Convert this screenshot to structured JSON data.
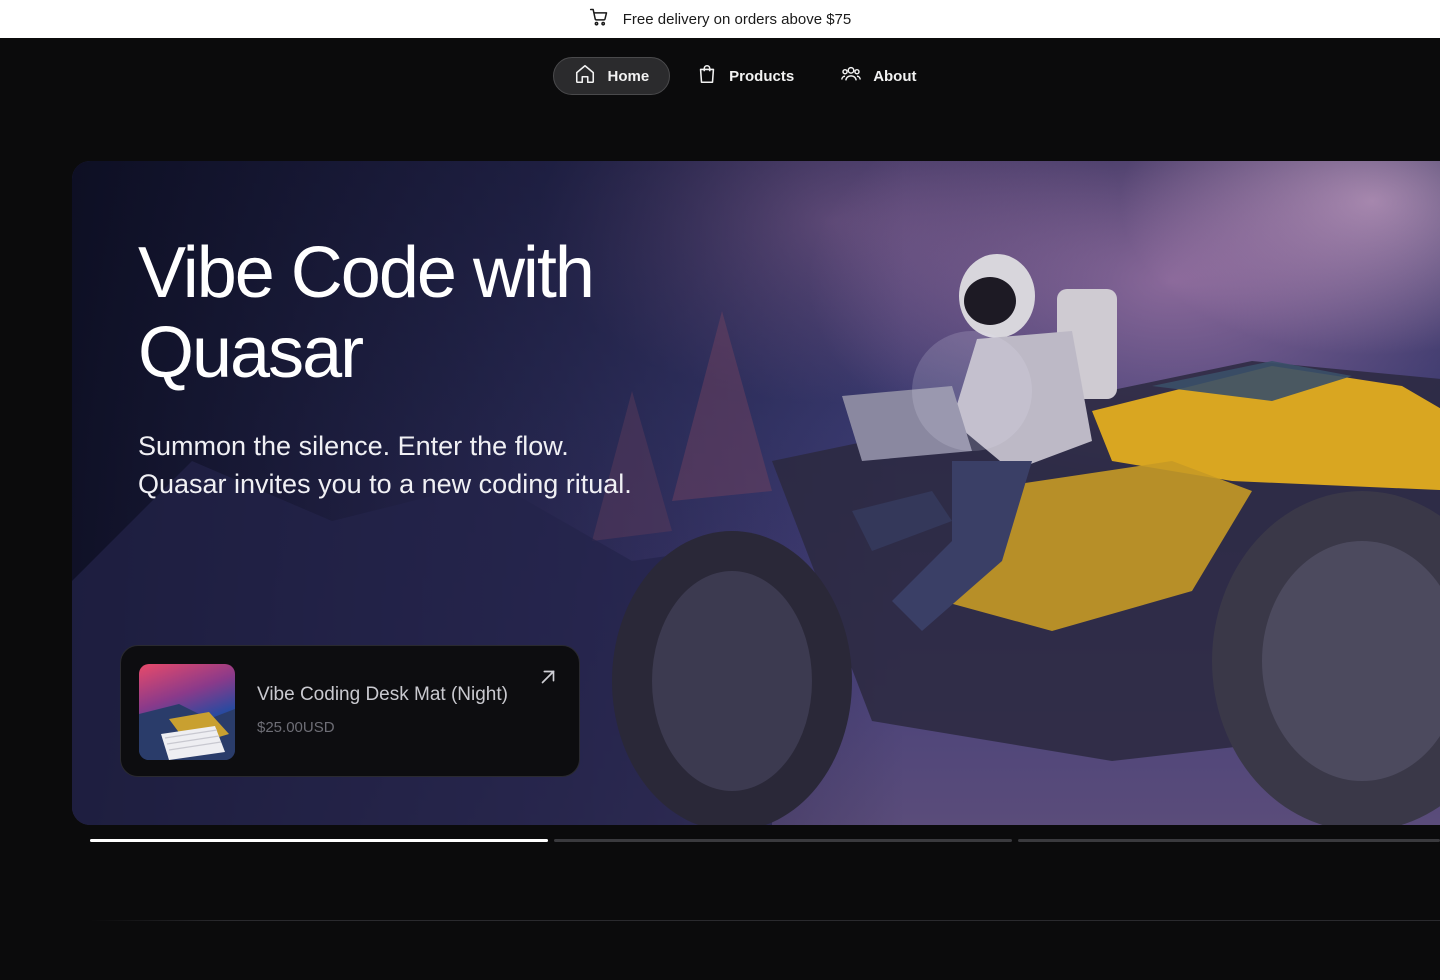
{
  "announcement": {
    "text": "Free delivery on orders above $75",
    "icon": "cart-icon"
  },
  "nav": {
    "items": [
      {
        "label": "Home",
        "icon": "home-icon",
        "active": true
      },
      {
        "label": "Products",
        "icon": "shopping-bag-icon",
        "active": false
      },
      {
        "label": "About",
        "icon": "users-icon",
        "active": false
      }
    ]
  },
  "hero": {
    "title_line1": "Vibe Code with",
    "title_line2": "Quasar",
    "subtitle_line1": "Summon the silence. Enter the flow.",
    "subtitle_line2": "Quasar invites you to a new coding ritual."
  },
  "featured_product": {
    "title": "Vibe Coding Desk Mat (Night)",
    "price": "$25.00USD",
    "link_icon": "arrow-up-right-icon"
  },
  "slider": {
    "slide_count": 3,
    "active_index": 0,
    "active_progress": 1.0
  },
  "colors": {
    "page_bg": "#0b0b0c",
    "announce_bg": "#ffffff",
    "nav_active_bg": "#2b2b2d",
    "accent_yellow": "#d9a621"
  }
}
